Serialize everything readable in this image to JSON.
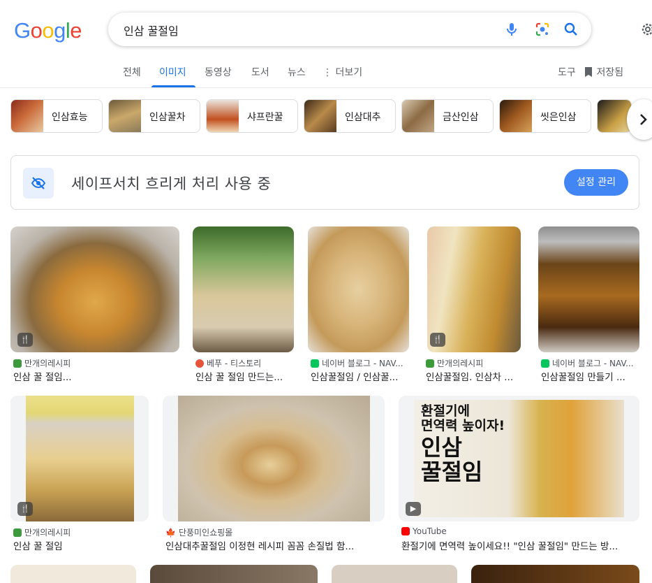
{
  "search": {
    "query": "인삼 꿀절임"
  },
  "tabs": [
    {
      "label": "전체"
    },
    {
      "label": "이미지"
    },
    {
      "label": "동영상"
    },
    {
      "label": "도서"
    },
    {
      "label": "뉴스"
    },
    {
      "label": "더보기"
    },
    {
      "label": "도구"
    },
    {
      "label": "저장됨"
    }
  ],
  "chips": [
    {
      "label": "인삼효능"
    },
    {
      "label": "인삼꿀차"
    },
    {
      "label": "샤프란꿀"
    },
    {
      "label": "인삼대추"
    },
    {
      "label": "금산인삼"
    },
    {
      "label": "씻은인삼"
    }
  ],
  "safesearch": {
    "text": "세이프서치 흐리게 처리 사용 중",
    "button": "설정 관리"
  },
  "results": [
    {
      "source": "만개의레시피",
      "title": "인삼 꿀 절임..."
    },
    {
      "source": "베푸 - 티스토리",
      "title": "인삼 꿀 절임 만드는..."
    },
    {
      "source": "네이버 블로그 - NAV...",
      "title": "인삼꿀절임 / 인삼꿀..."
    },
    {
      "source": "만개의레시피",
      "title": "인삼꿀절임. 인삼차 ..."
    },
    {
      "source": "네이버 블로그 - NAV...",
      "title": "인삼꿀절임 만들기 ..."
    },
    {
      "source": "만개의레시피",
      "title": "인삼 꿀 절임"
    },
    {
      "source": "단풍미인쇼핑몰",
      "title": "인삼대추꿀절임 이정현 레시피 꼼꼼 손질법 함..."
    },
    {
      "source": "YouTube",
      "title": "환절기에 면역력 높이세요!! \"인삼 꿀절임\" 만드는 방..."
    }
  ],
  "youtube_overlay": {
    "line1": "환절기에",
    "line2": "면역력 높이자!",
    "line3": "인삼",
    "line4": "꿀절임"
  },
  "colors": {
    "accent": "#1a73e8",
    "button": "#4285f4"
  }
}
